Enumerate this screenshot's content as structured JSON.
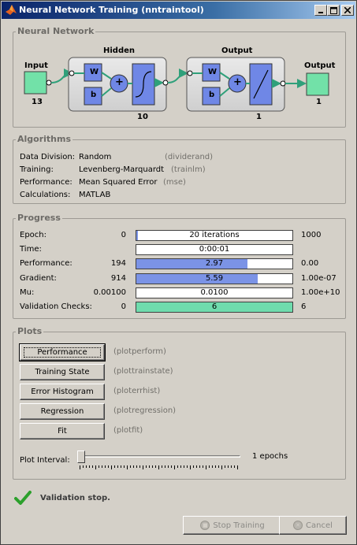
{
  "window": {
    "title": "Neural Network Training (nntraintool)",
    "controls": {
      "minimize": "minimize",
      "maximize": "maximize",
      "close": "close"
    }
  },
  "network": {
    "section_title": "Neural Network",
    "input_label": "Input",
    "input_size": "13",
    "hidden_label": "Hidden",
    "hidden_size": "10",
    "output_layer_label": "Output",
    "output_layer_size": "1",
    "output_label": "Output",
    "output_size": "1",
    "weight_symbol": "W",
    "bias_symbol": "b",
    "sum_symbol": "+"
  },
  "algorithms": {
    "section_title": "Algorithms",
    "rows": [
      {
        "label": "Data Division:",
        "value": "Random",
        "fn": "(dividerand)"
      },
      {
        "label": "Training:",
        "value": "Levenberg-Marquardt",
        "fn": "(trainlm)"
      },
      {
        "label": "Performance:",
        "value": "Mean Squared Error",
        "fn": "(mse)"
      },
      {
        "label": "Calculations:",
        "value": "MATLAB",
        "fn": ""
      }
    ]
  },
  "progress": {
    "section_title": "Progress",
    "rows": [
      {
        "label": "Epoch:",
        "start": "0",
        "value": "20 iterations",
        "end": "1000",
        "fill": 0.01,
        "color": "#7b93e6"
      },
      {
        "label": "Time:",
        "start": "",
        "value": "0:00:01",
        "end": "",
        "fill": 0,
        "color": "#7b93e6"
      },
      {
        "label": "Performance:",
        "start": "194",
        "value": "2.97",
        "end": "0.00",
        "fill": 0.71,
        "color": "#7b93e6"
      },
      {
        "label": "Gradient:",
        "start": "914",
        "value": "5.59",
        "end": "1.00e-07",
        "fill": 0.78,
        "color": "#7b93e6"
      },
      {
        "label": "Mu:",
        "start": "0.00100",
        "value": "0.0100",
        "end": "1.00e+10",
        "fill": 0,
        "color": "#7b93e6"
      },
      {
        "label": "Validation Checks:",
        "start": "0",
        "value": "6",
        "end": "6",
        "fill": 1.0,
        "color": "#6fdcad"
      }
    ]
  },
  "plots": {
    "section_title": "Plots",
    "buttons": [
      {
        "label": "Performance",
        "fn": "(plotperform)"
      },
      {
        "label": "Training State",
        "fn": "(plottrainstate)"
      },
      {
        "label": "Error Histogram",
        "fn": "(ploterrhist)"
      },
      {
        "label": "Regression",
        "fn": "(plotregression)"
      },
      {
        "label": "Fit",
        "fn": "(plotfit)"
      }
    ],
    "interval_label": "Plot Interval:",
    "interval_value": "1 epochs",
    "interval_level": 0
  },
  "status": {
    "message": "Validation stop.",
    "icon": "checkmark-icon",
    "icon_color": "#2ca02c"
  },
  "footer": {
    "stop_label": "Stop Training",
    "cancel_label": "Cancel",
    "stop_icon": "stop-icon",
    "cancel_icon": "cancel-icon"
  }
}
